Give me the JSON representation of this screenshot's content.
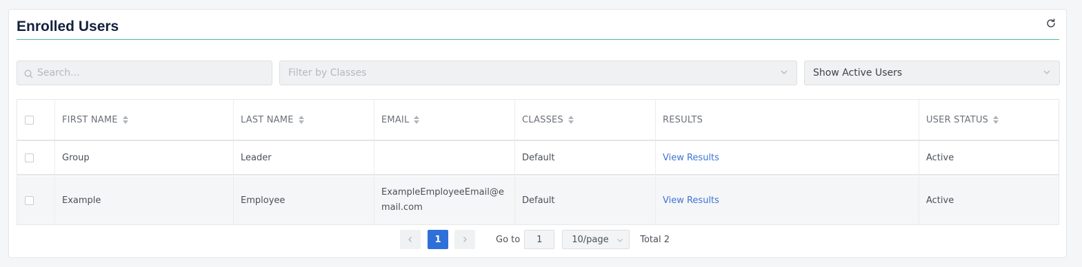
{
  "header": {
    "title": "Enrolled Users",
    "refresh_icon": "refresh-icon"
  },
  "filters": {
    "search_placeholder": "Search...",
    "classes_placeholder": "Filter by Classes",
    "status_value": "Show Active Users"
  },
  "table": {
    "columns": [
      "FIRST NAME",
      "LAST NAME",
      "EMAIL",
      "CLASSES",
      "RESULTS",
      "USER STATUS"
    ],
    "rows": [
      {
        "first": "Group",
        "last": "Leader",
        "email": "",
        "classes": "Default",
        "results": "View Results",
        "status": "Active"
      },
      {
        "first": "Example",
        "last": "Employee",
        "email": "ExampleEmployeeEmail@email.com",
        "classes": "Default",
        "results": "View Results",
        "status": "Active"
      }
    ]
  },
  "pagination": {
    "current_page": "1",
    "goto_label": "Go to",
    "goto_value": "1",
    "page_size": "10/page",
    "total": "Total 2"
  },
  "colors": {
    "accent": "#4fb990",
    "primary": "#2f6fd9",
    "link": "#3d73d6",
    "title": "#14213d"
  }
}
